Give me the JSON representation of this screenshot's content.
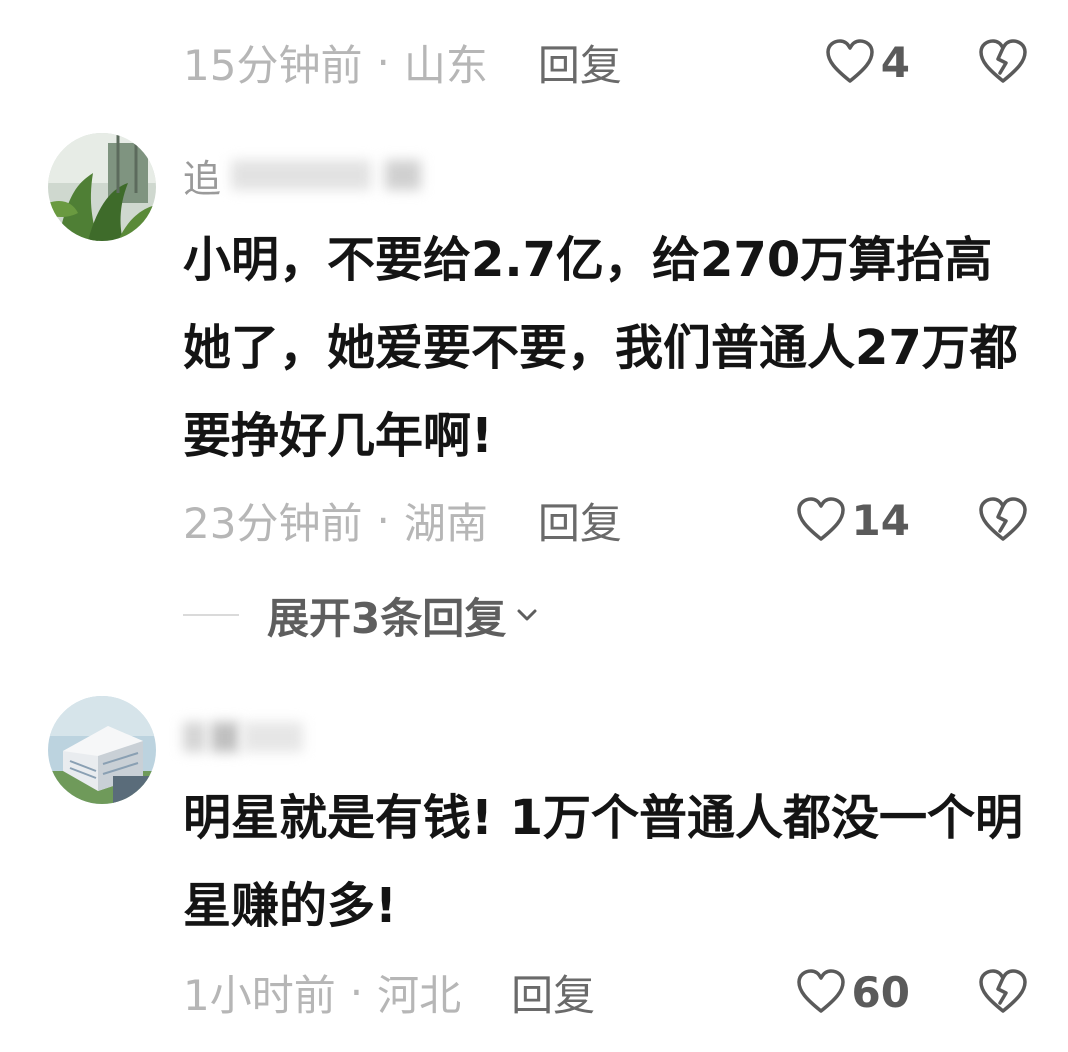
{
  "comments": [
    {
      "time": "15分钟前",
      "location": "山东",
      "reply_label": "回复",
      "likes": "4"
    },
    {
      "username_partial": "追",
      "text": "小明，不要给2.7亿，给270万算抬高她了，她爱要不要，我们普通人27万都要挣好几年啊!",
      "time": "23分钟前",
      "location": "湖南",
      "reply_label": "回复",
      "likes": "14",
      "expand_label": "展开3条回复"
    },
    {
      "text": "明星就是有钱! 1万个普通人都没一个明星赚的多!",
      "time": "1小时前",
      "location": "河北",
      "reply_label": "回复",
      "likes": "60"
    }
  ],
  "separator": "·",
  "icons": {
    "like": "heart-outline-icon",
    "dislike": "broken-heart-icon",
    "expand": "chevron-down-icon"
  },
  "colors": {
    "meta_gray": "#b6b6b6",
    "reply_gray": "#6a6a6a",
    "text_dark": "#141414"
  }
}
